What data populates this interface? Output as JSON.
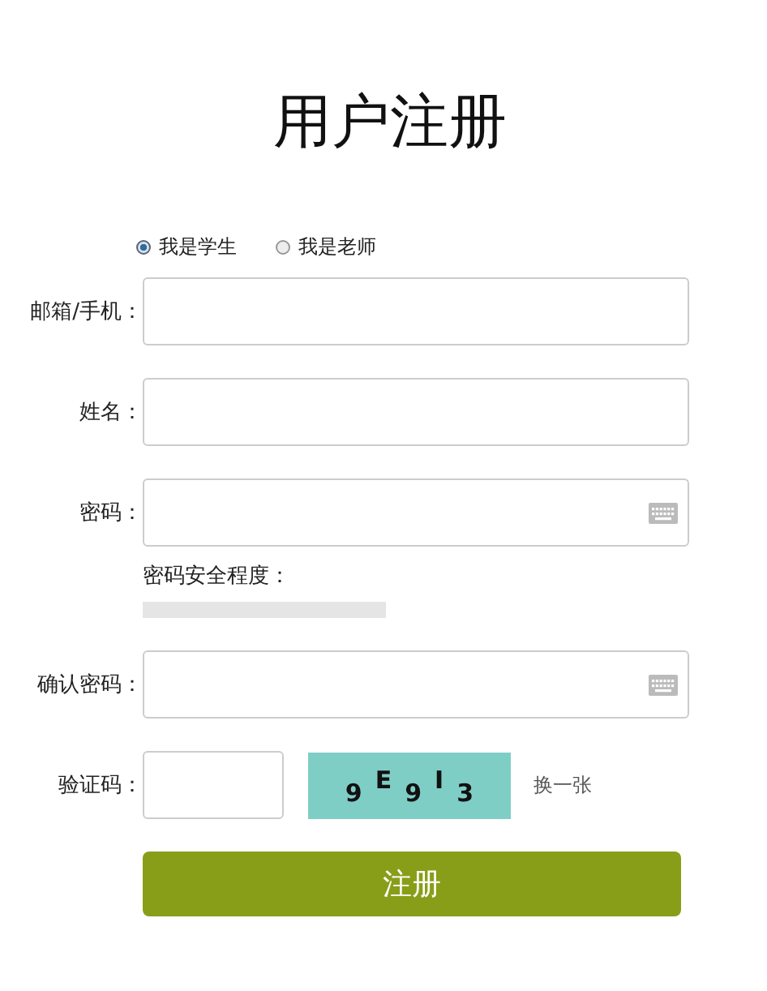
{
  "title": "用户注册",
  "roles": [
    {
      "label": "我是学生",
      "selected": true
    },
    {
      "label": "我是老师",
      "selected": false
    }
  ],
  "fields": [
    {
      "label": "邮箱/手机：",
      "kind": "text"
    },
    {
      "label": "姓名：",
      "kind": "text"
    },
    {
      "label": "密码：",
      "kind": "password"
    },
    {
      "kind": "strength",
      "label": "密码安全程度：",
      "level": 0
    },
    {
      "label": "确认密码：",
      "kind": "password"
    },
    {
      "label": "验证码：",
      "kind": "captcha",
      "captcha_chars": [
        "9",
        "E",
        "9",
        "I",
        "3"
      ],
      "refresh_link": "换一张"
    }
  ],
  "submit_button": "注册"
}
